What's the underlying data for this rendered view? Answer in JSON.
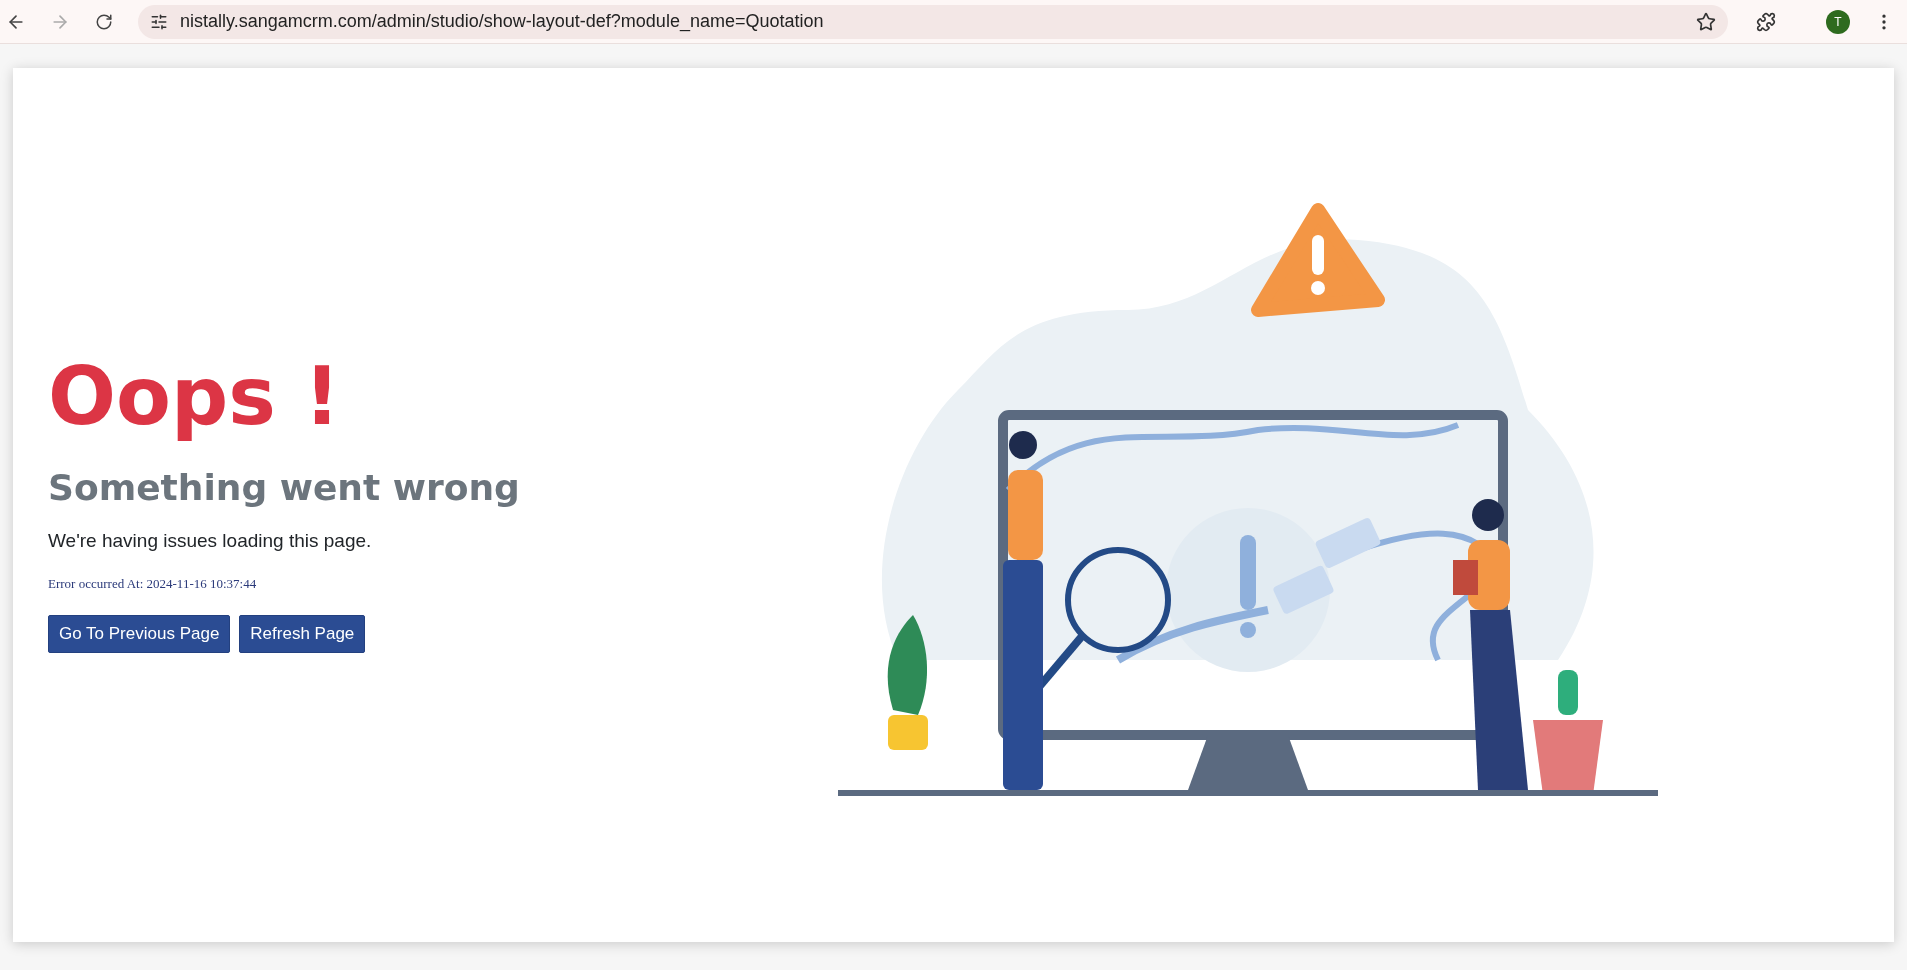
{
  "browser": {
    "url": "nistally.sangamcrm.com/admin/studio/show-layout-def?module_name=Quotation",
    "profile_initial": "T"
  },
  "error": {
    "title": "Oops !",
    "subtitle": "Something went wrong",
    "message": "We're having issues loading this page.",
    "timestamp": "Error occurred At: 2024-11-16 10:37:44"
  },
  "buttons": [
    {
      "label": "Go To Previous Page"
    },
    {
      "label": "Refresh Page"
    }
  ]
}
